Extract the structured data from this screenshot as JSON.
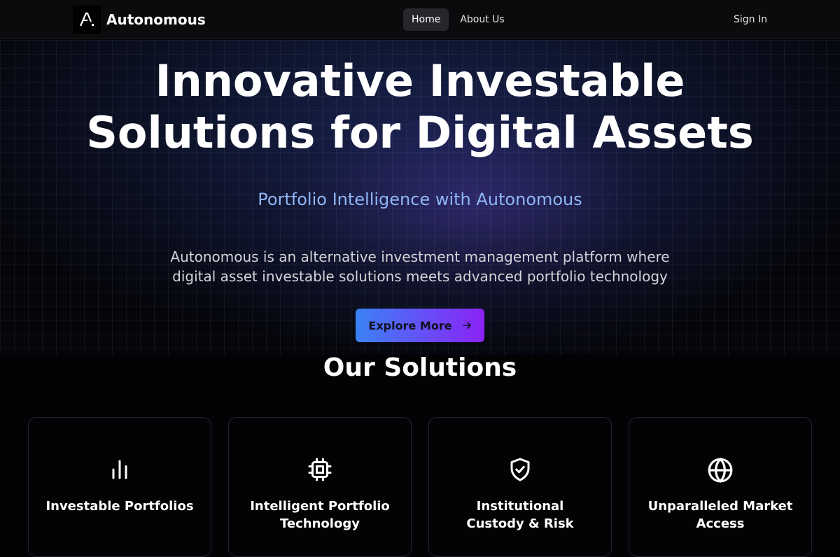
{
  "nav": {
    "brand_name": "Autonomous",
    "links": [
      {
        "label": "Home",
        "active": true
      },
      {
        "label": "About Us",
        "active": false
      }
    ],
    "sign_in": "Sign In"
  },
  "hero": {
    "title_line1": "Innovative Investable",
    "title_line2": "Solutions for Digital Assets",
    "subtitle": "Portfolio Intelligence with Autonomous",
    "description_line1": "Autonomous is an alternative investment management platform where",
    "description_line2": "digital asset investable solutions meets advanced portfolio technology",
    "cta_label": "Explore More"
  },
  "solutions": {
    "title": "Our Solutions",
    "cards": [
      {
        "icon": "bar-chart-icon",
        "title_line1": "Investable Portfolios",
        "title_line2": ""
      },
      {
        "icon": "cpu-chip-icon",
        "title_line1": "Intelligent Portfolio",
        "title_line2": "Technology"
      },
      {
        "icon": "shield-check-icon",
        "title_line1": "Institutional",
        "title_line2": "Custody & Risk"
      },
      {
        "icon": "globe-icon",
        "title_line1": "Unparalleled Market",
        "title_line2": "Access"
      }
    ]
  },
  "colors": {
    "accent_gradient_start": "#3b82f6",
    "accent_gradient_end": "#8b22f5",
    "subtitle": "#8fb6f4"
  }
}
